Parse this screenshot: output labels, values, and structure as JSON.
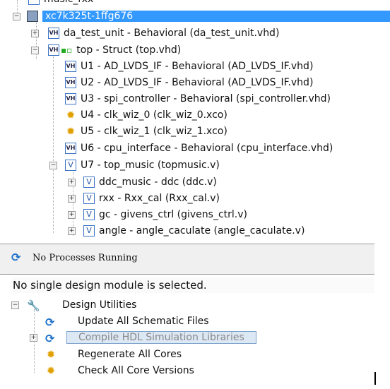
{
  "tree": {
    "partial_item": "music_rxx",
    "root": "xc7k325t-1ffg676",
    "items": [
      {
        "label": "da_test_unit - Behavioral (da_test_unit.vhd)",
        "icon": "vhdl-file-icon"
      },
      {
        "label": "top - Struct (top.vhd)",
        "icon": "vhdl-file-icon"
      },
      {
        "label": "U1 - AD_LVDS_IF - Behavioral (AD_LVDS_IF.vhd)",
        "icon": "vhdl-file-icon"
      },
      {
        "label": "U2 - AD_LVDS_IF - Behavioral (AD_LVDS_IF.vhd)",
        "icon": "vhdl-file-icon"
      },
      {
        "label": "U3 - spi_controller - Behavioral (spi_controller.vhd)",
        "icon": "vhdl-file-icon"
      },
      {
        "label": "U4 - clk_wiz_0 (clk_wiz_0.xco)",
        "icon": "core-bulb-icon"
      },
      {
        "label": "U5 - clk_wiz_1 (clk_wiz_1.xco)",
        "icon": "core-bulb-icon"
      },
      {
        "label": "U6 - cpu_interface - Behavioral (cpu_interface.vhd)",
        "icon": "vhdl-file-icon"
      },
      {
        "label": "U7 - top_music (topmusic.v)",
        "icon": "verilog-file-icon"
      },
      {
        "label": "ddc_music - ddc (ddc.v)",
        "icon": "verilog-file-icon"
      },
      {
        "label": "rxx - Rxx_cal (Rxx_cal.v)",
        "icon": "verilog-file-icon"
      },
      {
        "label": "gc - givens_ctrl (givens_ctrl.v)",
        "icon": "verilog-file-icon"
      },
      {
        "label": "angle - angle_caculate (angle_caculate.v)",
        "icon": "verilog-file-icon"
      }
    ]
  },
  "status": {
    "processes": "No Processes Running"
  },
  "processes": {
    "message": "No single design module is selected.",
    "group": "Design Utilities",
    "items": [
      "Update All Schematic Files",
      "Compile HDL Simulation Libraries",
      "Regenerate All Cores",
      "Check All Core Versions"
    ]
  },
  "colors": {
    "selection": "#3399ff"
  }
}
